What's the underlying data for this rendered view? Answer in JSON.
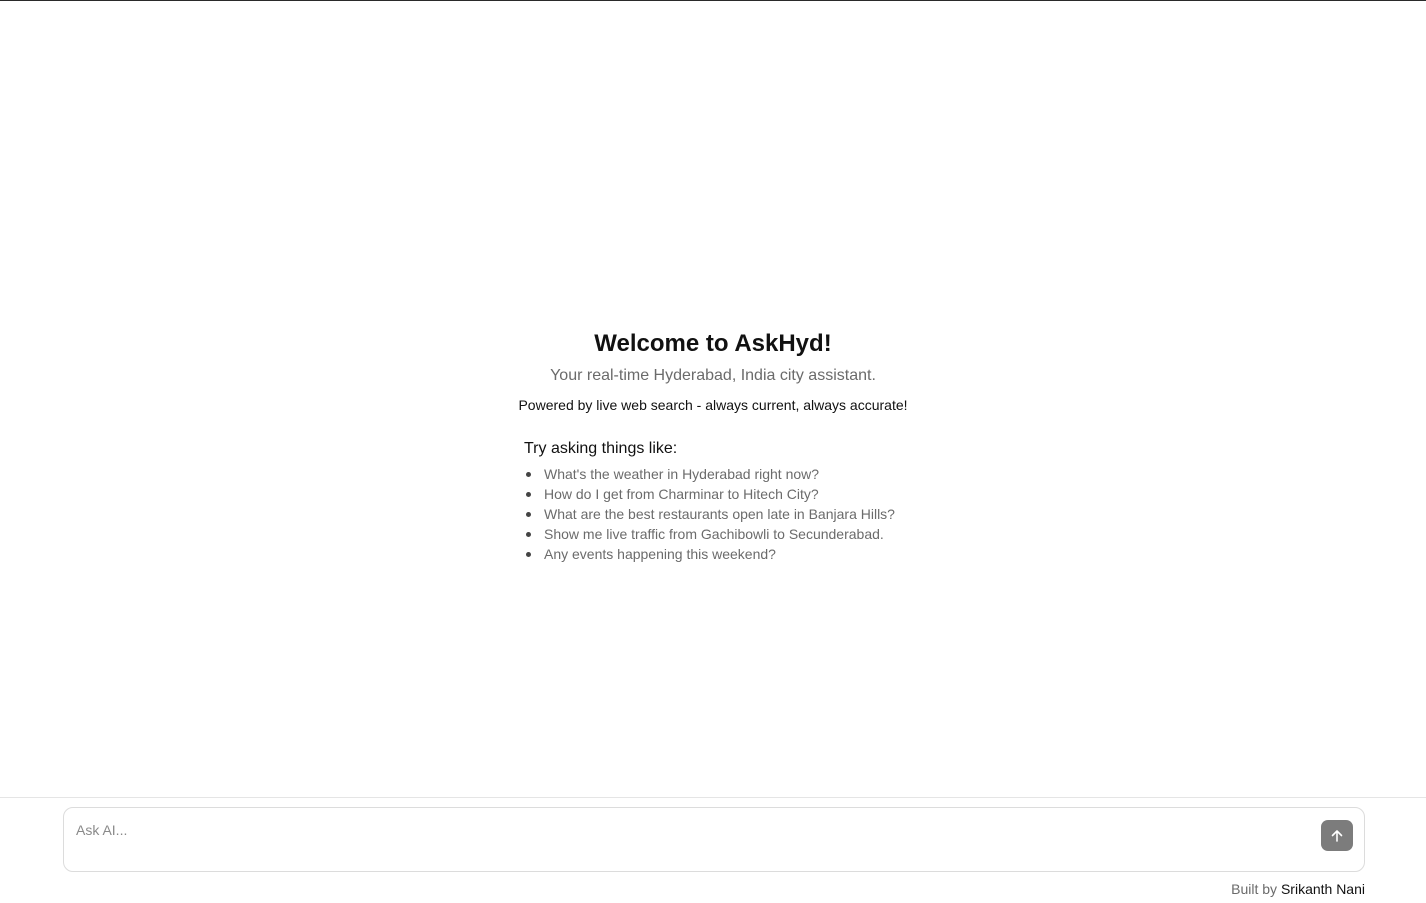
{
  "welcome": {
    "title": "Welcome to AskHyd!",
    "subtitle": "Your real-time Hyderabad, India city assistant.",
    "powered_by": "Powered by live web search - always current, always accurate!"
  },
  "suggestions": {
    "heading": "Try asking things like:",
    "items": [
      "What's the weather in Hyderabad right now?",
      "How do I get from Charminar to Hitech City?",
      "What are the best restaurants open late in Banjara Hills?",
      "Show me live traffic from Gachibowli to Secunderabad.",
      "Any events happening this weekend?"
    ]
  },
  "chat": {
    "placeholder": "Ask AI...",
    "value": "",
    "send_icon": "arrow-up-icon"
  },
  "footer": {
    "built_by_label": "Built by",
    "author": "Srikanth Nani"
  },
  "colors": {
    "text_primary": "#111111",
    "text_muted": "#6b6b6b",
    "send_button": "#7c7c7c",
    "border": "#dcdcdc"
  }
}
